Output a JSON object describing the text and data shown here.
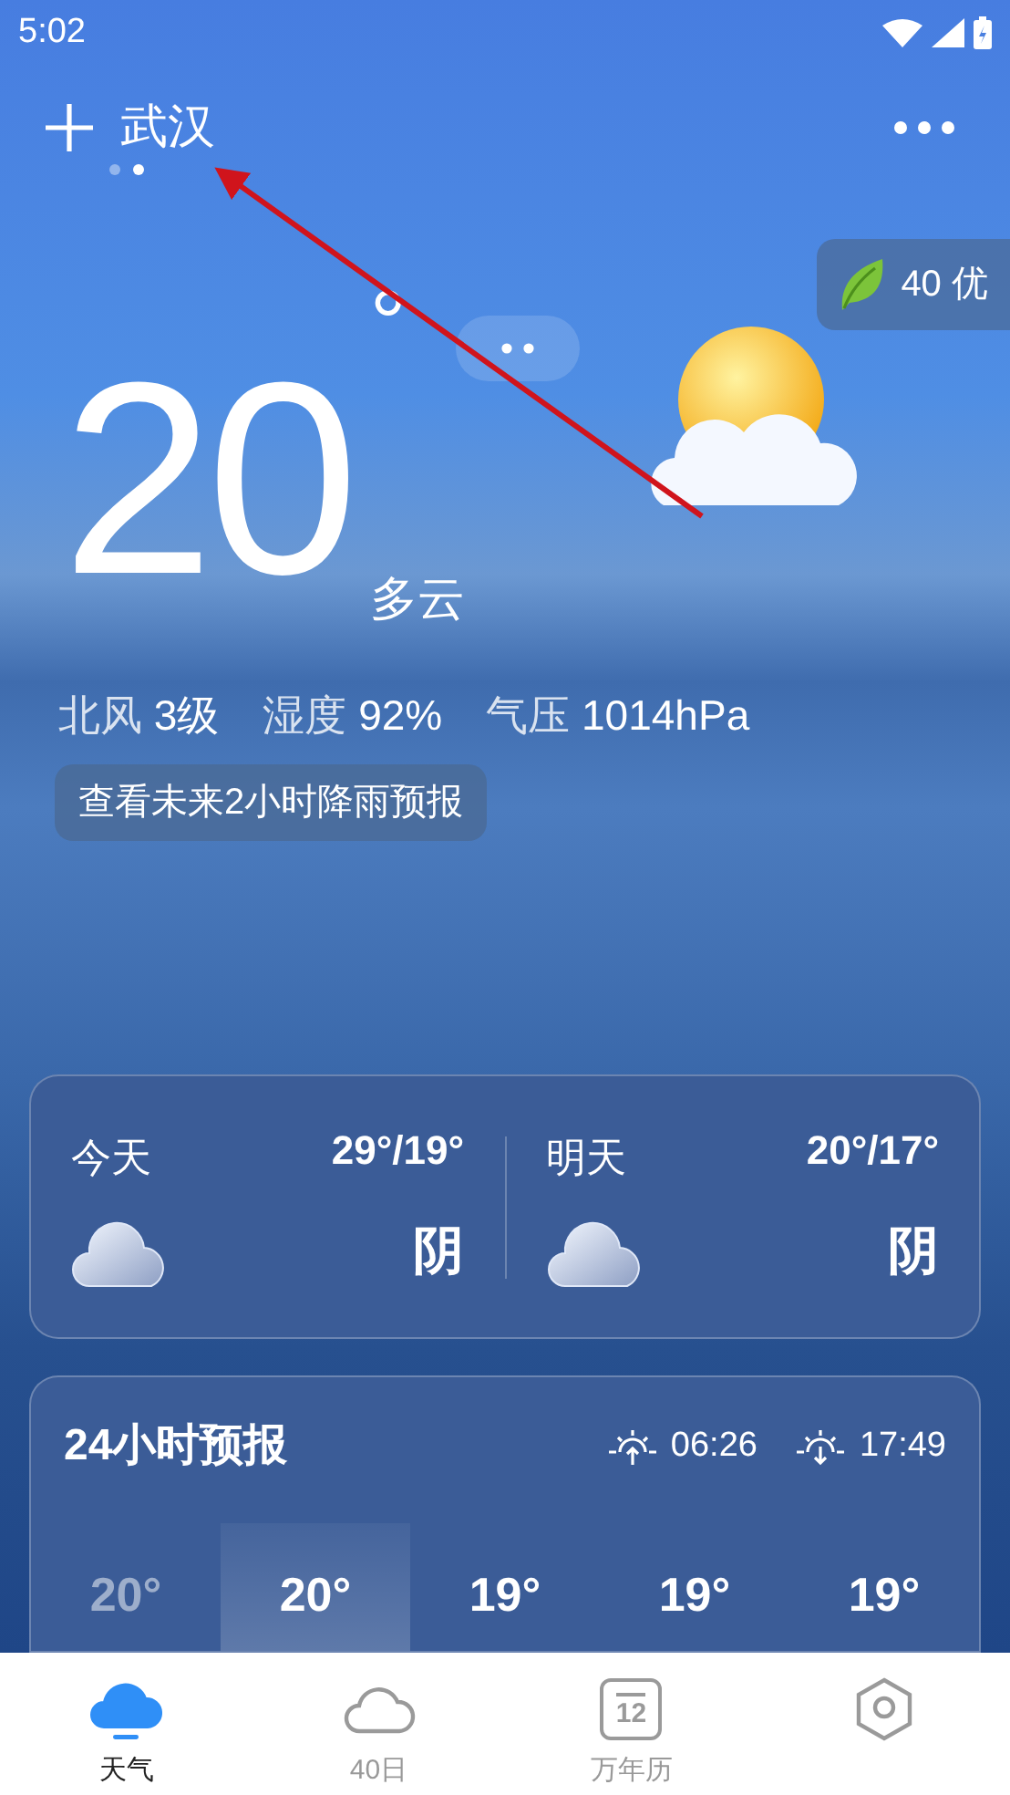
{
  "status_bar": {
    "time": "5:02"
  },
  "header": {
    "city": "武汉",
    "pages": [
      {
        "selected": false
      },
      {
        "selected": true
      }
    ]
  },
  "air_quality": {
    "value": "40 优"
  },
  "current": {
    "temperature": "20",
    "degree": "°",
    "condition": "多云"
  },
  "details": [
    {
      "label": "北风",
      "value": "3级"
    },
    {
      "label": "湿度",
      "value": "92%"
    },
    {
      "label": "气压",
      "value": "1014hPa"
    }
  ],
  "rain_forecast_button": "查看未来2小时降雨预报",
  "daily": [
    {
      "day": "今天",
      "temps": "29°/19°",
      "condition": "阴"
    },
    {
      "day": "明天",
      "temps": "20°/17°",
      "condition": "阴"
    }
  ],
  "hourly": {
    "title": "24小时预报",
    "sunrise": "06:26",
    "sunset": "17:49",
    "items": [
      {
        "temp": "20°",
        "past": true,
        "selected": false
      },
      {
        "temp": "20°",
        "past": false,
        "selected": true
      },
      {
        "temp": "19°",
        "past": false,
        "selected": false
      },
      {
        "temp": "19°",
        "past": false,
        "selected": false
      },
      {
        "temp": "19°",
        "past": false,
        "selected": false
      }
    ]
  },
  "tabs": [
    {
      "kind": "weather",
      "label": "天气",
      "selected": true
    },
    {
      "kind": "cloud",
      "label": "40日",
      "selected": false
    },
    {
      "kind": "calendar",
      "label": "万年历",
      "icon_text": "12",
      "selected": false
    },
    {
      "kind": "hexagon",
      "selected": false
    }
  ]
}
